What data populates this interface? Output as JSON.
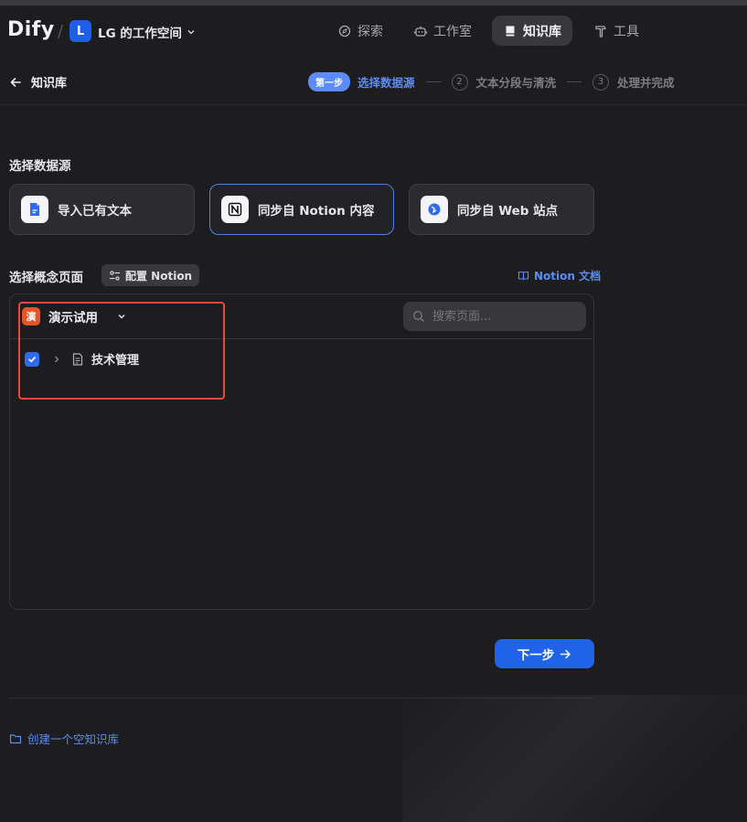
{
  "app": {
    "logo": "Dify"
  },
  "workspace": {
    "initial": "L",
    "name": "LG 的工作空间"
  },
  "nav": [
    {
      "label": "探索",
      "icon": "compass-icon",
      "active": false
    },
    {
      "label": "工作室",
      "icon": "robot-icon",
      "active": false
    },
    {
      "label": "知识库",
      "icon": "book-icon",
      "active": true
    },
    {
      "label": "工具",
      "icon": "hammer-icon",
      "active": false
    }
  ],
  "subheader": {
    "back_label": "知识库"
  },
  "steps": {
    "current_pill": "第一步",
    "current_label": "选择数据源",
    "step2_num": "2",
    "step2_label": "文本分段与清洗",
    "step3_num": "3",
    "step3_label": "处理并完成"
  },
  "datasource": {
    "title": "选择数据源",
    "cards": [
      {
        "label": "导入已有文本",
        "icon": "file-icon",
        "selected": false
      },
      {
        "label": "同步自 Notion 内容",
        "icon": "notion-icon",
        "selected": true
      },
      {
        "label": "同步自 Web 站点",
        "icon": "web-icon",
        "selected": false
      }
    ]
  },
  "notion": {
    "title": "选择概念页面",
    "config_button": "配置 Notion",
    "doc_link": "Notion 文档",
    "workspace_avatar": "演",
    "workspace_name": "演示试用",
    "search_placeholder": "搜索页面...",
    "pages": [
      {
        "title": "技术管理",
        "checked": true
      }
    ]
  },
  "actions": {
    "next_label": "下一步",
    "create_empty_label": "创建一个空知识库"
  },
  "colors": {
    "accent": "#1f63e8",
    "link": "#5b8cf5",
    "highlight_box": "#e64a3c"
  }
}
